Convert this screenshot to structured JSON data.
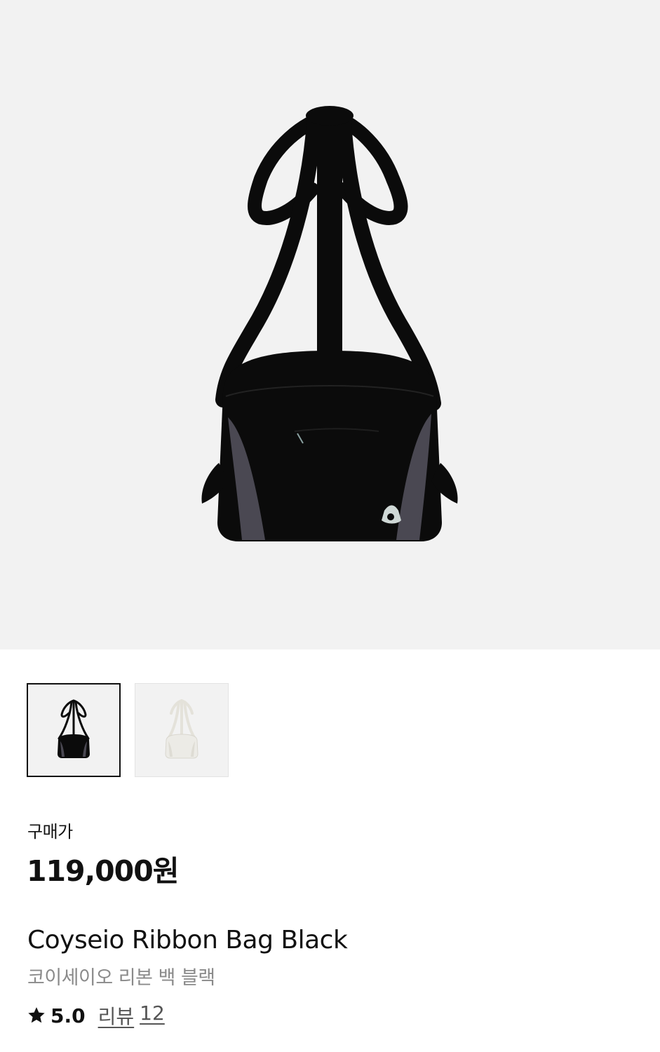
{
  "product": {
    "price_label": "구매가",
    "price": "119,000원",
    "name_en": "Coyseio Ribbon Bag Black",
    "name_ko": "코이세이오 리본 백 블랙",
    "rating": "5.0",
    "reviews_label": "리뷰",
    "reviews_count": "12"
  },
  "thumbnails": [
    {
      "variant": "black",
      "selected": true
    },
    {
      "variant": "ivory",
      "selected": false
    }
  ],
  "colors": {
    "hero_bg": "#f2f2f2",
    "bag_black": "#0b0b0b",
    "bag_panel_gray": "#4a4852",
    "bag_ivory": "#ecebe6"
  },
  "icons": {
    "rating": "star-icon"
  }
}
